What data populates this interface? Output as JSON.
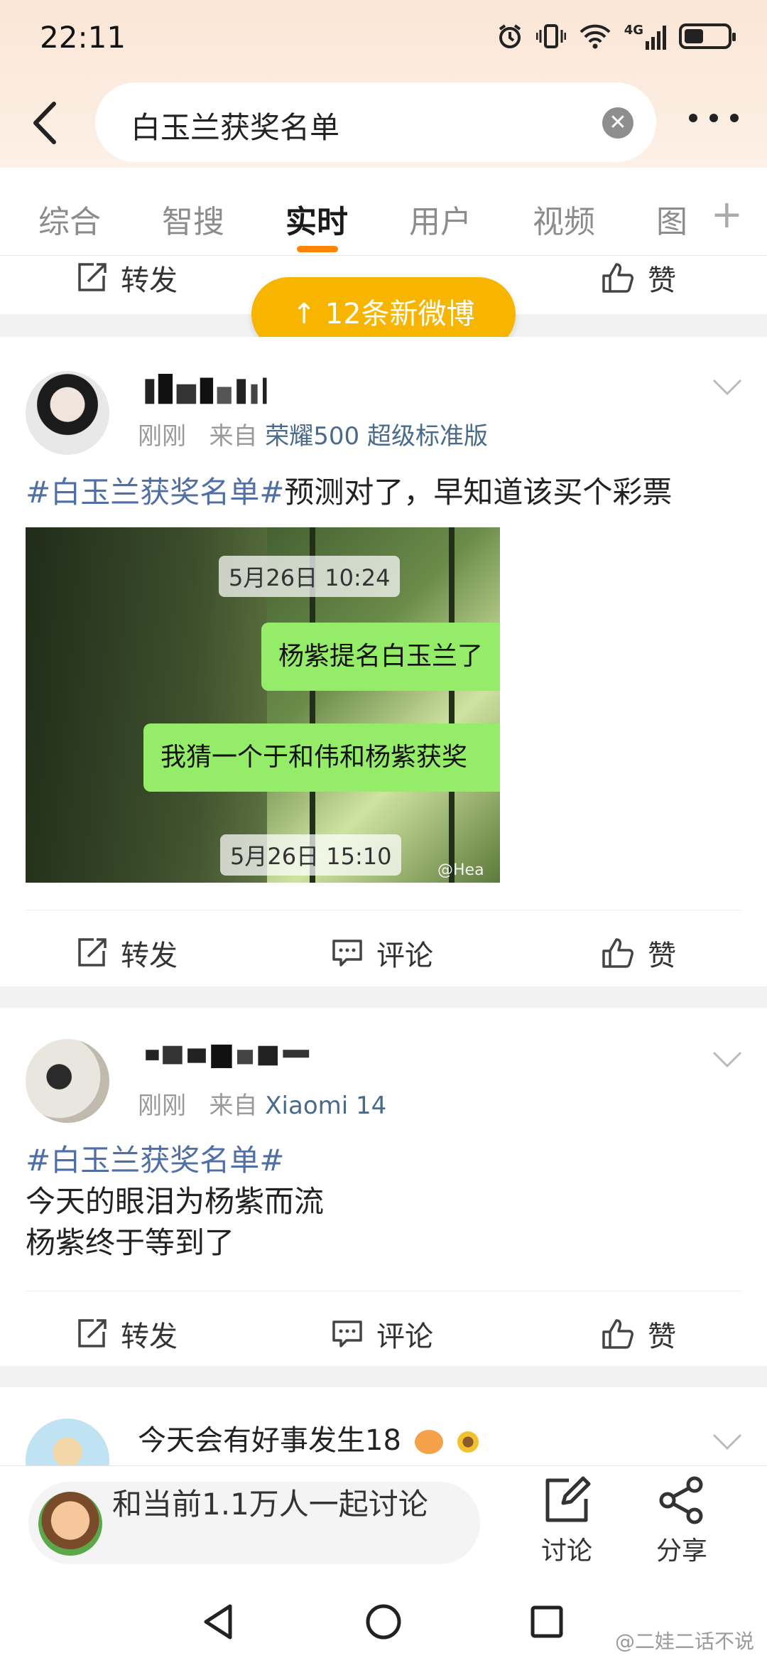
{
  "status_bar": {
    "time": "22:11",
    "network": "4G"
  },
  "search": {
    "query": "白玉兰获奖名单"
  },
  "tabs": [
    {
      "label": "综合"
    },
    {
      "label": "智搜"
    },
    {
      "label": "实时"
    },
    {
      "label": "用户"
    },
    {
      "label": "视频"
    },
    {
      "label": "图"
    }
  ],
  "active_tab": "实时",
  "actions": {
    "repost": "转发",
    "comment": "评论",
    "like": "赞"
  },
  "toast": {
    "label": "12条新微博"
  },
  "posts": [
    {
      "time": "刚刚",
      "from_prefix": "来自",
      "source": "荣耀500 超级标准版",
      "tag": "#白玉兰获奖名单#",
      "text": "预测对了，早知道该买个彩票",
      "image": {
        "time1": "5月26日 10:24",
        "bubble1": "杨紫提名白玉兰了",
        "bubble2": "我猜一个于和伟和杨紫获奖",
        "time2": "5月26日 15:10",
        "watermark": "@Hea"
      }
    },
    {
      "time": "刚刚",
      "from_prefix": "来自",
      "source": "Xiaomi 14",
      "tag": "#白玉兰获奖名单#",
      "lines": [
        "今天的眼泪为杨紫而流",
        "杨紫终于等到了"
      ]
    },
    {
      "username": "今天会有好事发生18"
    }
  ],
  "bottom_bar": {
    "join_text": "和当前1.1万人一起讨论",
    "discuss": "讨论",
    "share": "分享"
  },
  "watermark": "@二娃二话不说",
  "colors": {
    "accent": "#ff8200",
    "toast": "#f7b500",
    "tag": "#4f6fa6",
    "bubble": "#95ec69"
  }
}
